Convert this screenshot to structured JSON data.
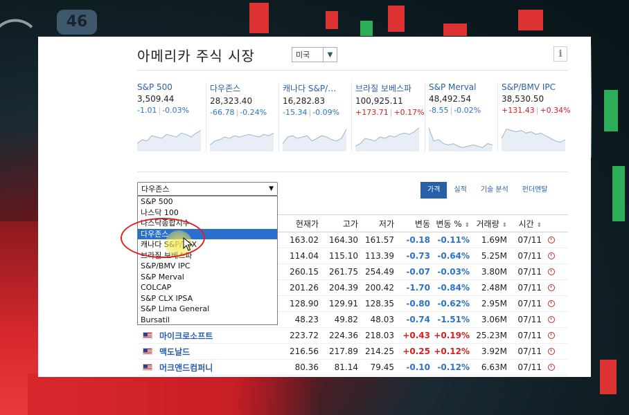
{
  "header": {
    "title": "아메리카 주식 시장",
    "country": "미국",
    "info_icon": "info-icon"
  },
  "indices": [
    {
      "name": "S&P 500",
      "price": "3,509.44",
      "chg": "-1.01",
      "pct": "-0.03%",
      "dir": "neg",
      "spark": [
        0.3,
        0.45,
        0.4,
        0.6,
        0.55,
        0.5,
        0.65,
        0.6,
        0.55,
        0.7,
        0.65,
        0.55,
        0.7,
        0.8
      ]
    },
    {
      "name": "다우존스",
      "price": "28,323.40",
      "chg": "-66.78",
      "pct": "-0.24%",
      "dir": "neg",
      "spark": [
        0.25,
        0.4,
        0.45,
        0.55,
        0.5,
        0.6,
        0.55,
        0.6,
        0.65,
        0.6,
        0.55,
        0.65,
        0.6,
        0.7
      ]
    },
    {
      "name": "캐나다 S&P/…",
      "price": "16,282.83",
      "chg": "-15.34",
      "pct": "-0.09%",
      "dir": "neg",
      "spark": [
        0.3,
        0.55,
        0.6,
        0.5,
        0.55,
        0.6,
        0.4,
        0.5,
        0.6,
        0.55,
        0.45,
        0.4,
        0.5,
        0.85
      ]
    },
    {
      "name": "브라질 보베스파",
      "price": "100,925.11",
      "chg": "+173.71",
      "pct": "+0.17%",
      "dir": "pos",
      "spark": [
        0.2,
        0.3,
        0.5,
        0.45,
        0.4,
        0.55,
        0.5,
        0.6,
        0.55,
        0.65,
        0.7,
        0.65,
        0.75,
        0.9
      ]
    },
    {
      "name": "S&P Merval",
      "price": "48,492.54",
      "chg": "-8.55",
      "pct": "-0.02%",
      "dir": "neg",
      "spark": [
        0.9,
        0.4,
        0.45,
        0.3,
        0.25,
        0.3,
        0.2,
        0.15,
        0.2,
        0.25,
        0.2,
        0.15,
        0.3,
        0.25
      ]
    },
    {
      "name": "S&P/BMV IPC",
      "price": "38,530.50",
      "chg": "+131.43",
      "pct": "+0.34%",
      "dir": "pos",
      "spark": [
        0.5,
        0.85,
        0.8,
        0.75,
        0.8,
        0.7,
        0.75,
        0.65,
        0.7,
        0.6,
        0.5,
        0.4,
        0.35,
        0.45
      ]
    }
  ],
  "index_select": {
    "value": "다우존스"
  },
  "dropdown": {
    "options": [
      "S&P 500",
      "나스닥 100",
      "나스닥종합지수",
      "다우존스",
      "캐나다 S&P/TSX",
      "브라질 보베스파",
      "S&P/BMV IPC",
      "S&P Merval",
      "COLCAP",
      "S&P CLX IPSA",
      "S&P Lima General",
      "Bursatil"
    ],
    "selected_index": 3
  },
  "tabs": [
    {
      "label": "가격",
      "active": true
    },
    {
      "label": "실적",
      "active": false
    },
    {
      "label": "기술 분석",
      "active": false
    },
    {
      "label": "펀더멘탈",
      "active": false
    }
  ],
  "table": {
    "headers": {
      "last": "현재가",
      "high": "고가",
      "low": "저가",
      "chg": "변동",
      "pct": "변동 %",
      "vol": "거래량",
      "time": "시간"
    },
    "rows": [
      {
        "name": "",
        "last": "163.02",
        "high": "164.30",
        "low": "161.57",
        "chg": "-0.18",
        "pct": "-0.11%",
        "vol": "1.69M",
        "time": "07/11",
        "dir": "neg"
      },
      {
        "name": "",
        "last": "114.04",
        "high": "115.10",
        "low": "113.39",
        "chg": "-0.73",
        "pct": "-0.64%",
        "vol": "5.25M",
        "time": "07/11",
        "dir": "neg"
      },
      {
        "name": "",
        "last": "260.15",
        "high": "261.75",
        "low": "254.49",
        "chg": "-0.07",
        "pct": "-0.03%",
        "vol": "3.80M",
        "time": "07/11",
        "dir": "neg"
      },
      {
        "name": "",
        "last": "201.26",
        "high": "204.39",
        "low": "200.42",
        "chg": "-1.70",
        "pct": "-0.84%",
        "vol": "2.48M",
        "time": "07/11",
        "dir": "neg"
      },
      {
        "name": "",
        "last": "128.90",
        "high": "129.91",
        "low": "128.35",
        "chg": "-0.80",
        "pct": "-0.62%",
        "vol": "2.95M",
        "time": "07/11",
        "dir": "neg"
      },
      {
        "name": "",
        "last": "48.23",
        "high": "49.82",
        "low": "48.03",
        "chg": "-0.74",
        "pct": "-1.51%",
        "vol": "3.06M",
        "time": "07/11",
        "dir": "neg"
      },
      {
        "name": "마이크로소프트",
        "last": "223.72",
        "high": "224.36",
        "low": "218.03",
        "chg": "+0.43",
        "pct": "+0.19%",
        "vol": "25.23M",
        "time": "07/11",
        "dir": "pos"
      },
      {
        "name": "맥도날드",
        "last": "216.56",
        "high": "217.89",
        "low": "214.25",
        "chg": "+0.25",
        "pct": "+0.12%",
        "vol": "3.92M",
        "time": "07/11",
        "dir": "pos"
      },
      {
        "name": "머크앤드컴퍼니",
        "last": "80.36",
        "high": "81.14",
        "low": "79.45",
        "chg": "-0.10",
        "pct": "-0.12%",
        "vol": "6.63M",
        "time": "07/11",
        "dir": "neg"
      }
    ]
  },
  "background": {
    "badge_text": "46"
  }
}
